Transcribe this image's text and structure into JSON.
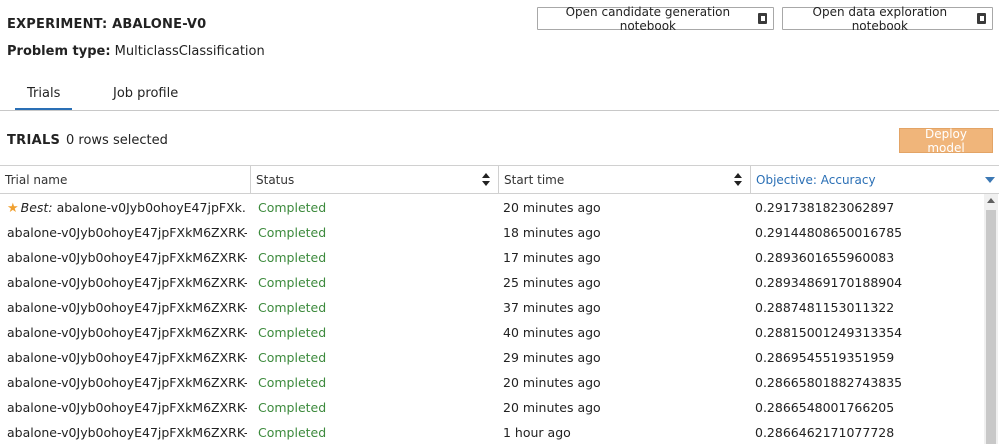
{
  "header": {
    "experiment_title": "EXPERIMENT: ABALONE-V0",
    "problem_label": "Problem type:",
    "problem_value": "MulticlassClassification",
    "open_candidate_label": "Open candidate generation notebook",
    "open_exploration_label": "Open data exploration notebook"
  },
  "tabs": [
    {
      "label": "Trials",
      "active": true
    },
    {
      "label": "Job profile",
      "active": false
    }
  ],
  "trials": {
    "title": "TRIALS",
    "selection_text": "0 rows selected",
    "deploy_label": "Deploy model"
  },
  "table": {
    "columns": [
      "Trial name",
      "Status",
      "Start time",
      "Objective: Accuracy"
    ],
    "best_prefix": "Best:",
    "rows": [
      {
        "name": "abalone-v0Jyb0ohoyE47jpFXk...",
        "status": "Completed",
        "start": "20 minutes ago",
        "objective": "0.2917381823062897"
      },
      {
        "name": "abalone-v0Jyb0ohoyE47jpFXkM6ZXRK-...",
        "status": "Completed",
        "start": "18 minutes ago",
        "objective": "0.29144808650016785"
      },
      {
        "name": "abalone-v0Jyb0ohoyE47jpFXkM6ZXRK-...",
        "status": "Completed",
        "start": "17 minutes ago",
        "objective": "0.2893601655960083"
      },
      {
        "name": "abalone-v0Jyb0ohoyE47jpFXkM6ZXRK-...",
        "status": "Completed",
        "start": "25 minutes ago",
        "objective": "0.28934869170188904"
      },
      {
        "name": "abalone-v0Jyb0ohoyE47jpFXkM6ZXRK-...",
        "status": "Completed",
        "start": "37 minutes ago",
        "objective": "0.2887481153011322"
      },
      {
        "name": "abalone-v0Jyb0ohoyE47jpFXkM6ZXRK-...",
        "status": "Completed",
        "start": "40 minutes ago",
        "objective": "0.28815001249313354"
      },
      {
        "name": "abalone-v0Jyb0ohoyE47jpFXkM6ZXRK-...",
        "status": "Completed",
        "start": "29 minutes ago",
        "objective": "0.2869545519351959"
      },
      {
        "name": "abalone-v0Jyb0ohoyE47jpFXkM6ZXRK-...",
        "status": "Completed",
        "start": "20 minutes ago",
        "objective": "0.28665801882743835"
      },
      {
        "name": "abalone-v0Jyb0ohoyE47jpFXkM6ZXRK-...",
        "status": "Completed",
        "start": "20 minutes ago",
        "objective": "0.2866548001766205"
      },
      {
        "name": "abalone-v0Jyb0ohoyE47jpFXkM6ZXRK-...",
        "status": "Completed",
        "start": "1 hour ago",
        "objective": "0.2866462171077728"
      }
    ]
  },
  "colors": {
    "accent": "#2a6fb5",
    "status_completed": "#3c8a3c",
    "deploy_button": "#f0b57a",
    "best_star": "#f0a030"
  },
  "icons": {
    "notebook": "notebook-icon",
    "best": "star-icon"
  }
}
